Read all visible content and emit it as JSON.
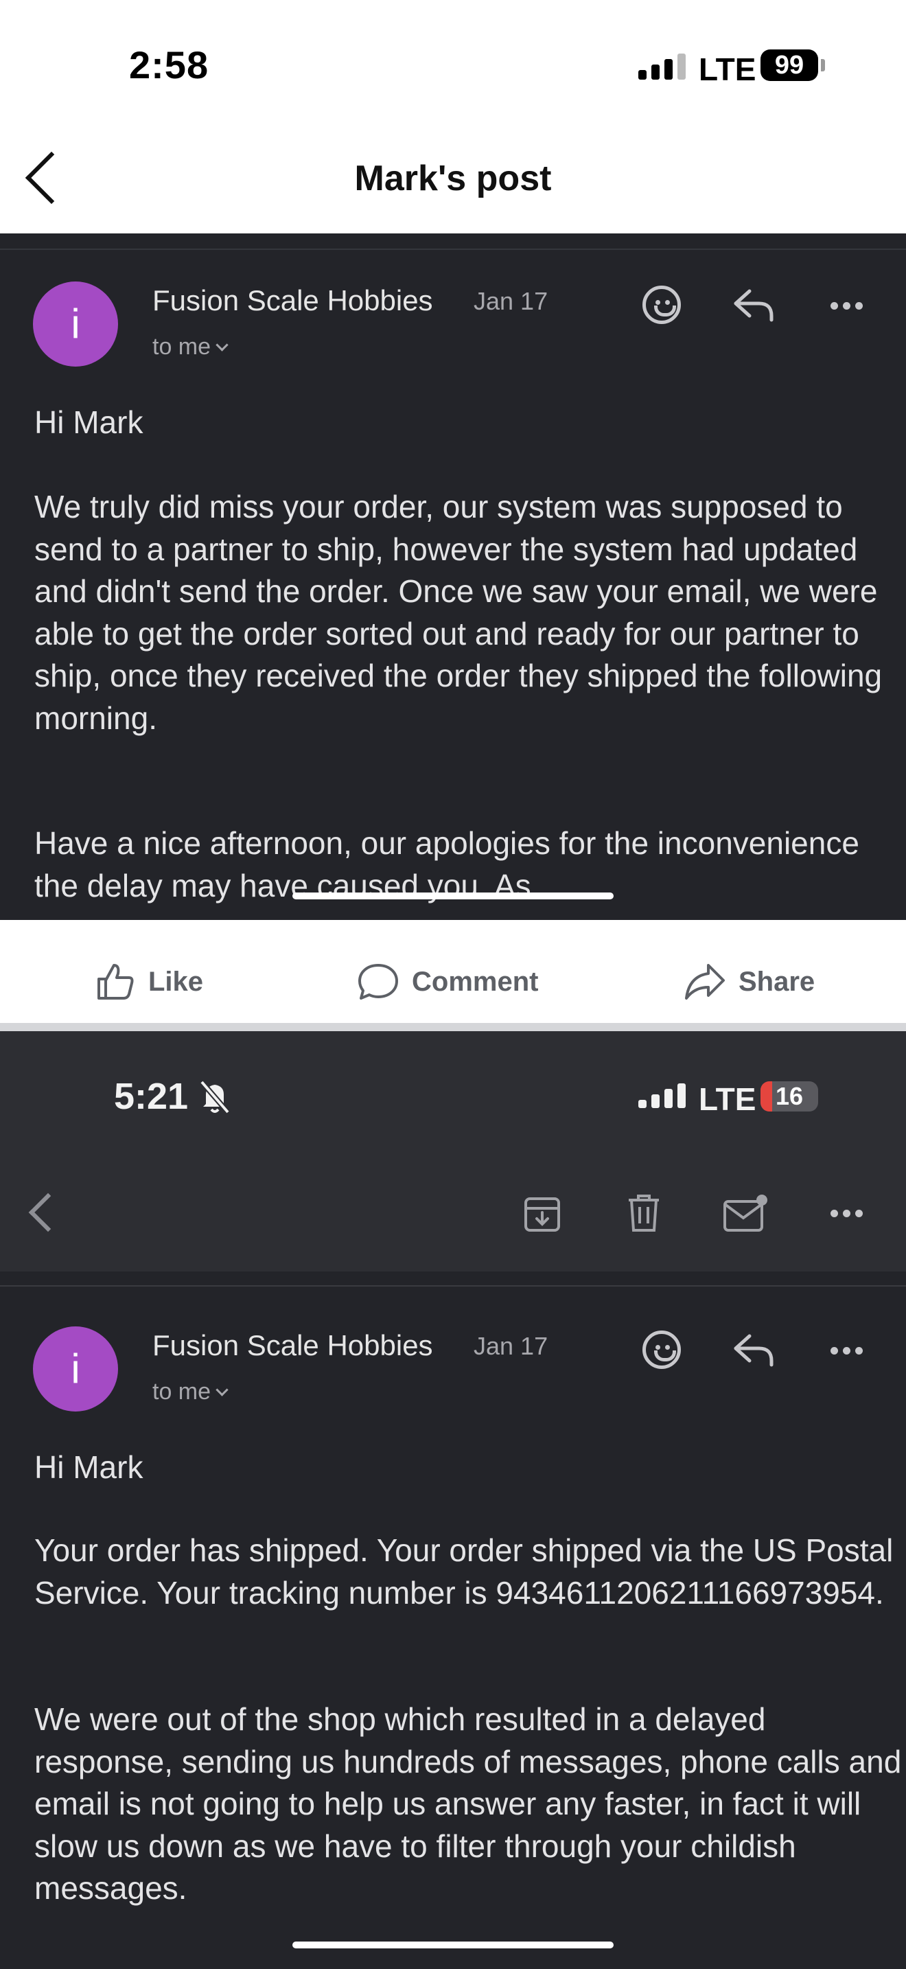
{
  "top_status_bar": {
    "time": "2:58",
    "network": "LTE",
    "battery": "99"
  },
  "post_header": {
    "title": "Mark's post"
  },
  "email1": {
    "avatar_letter": "i",
    "sender": "Fusion Scale Hobbies",
    "date": "Jan 17",
    "recipient": "to me",
    "greeting": "Hi Mark",
    "paragraph1": "We truly did miss your order, our system was supposed to send to a partner to ship, however the system had updated and didn't send the order. Once we saw your email, we were able to get the order sorted out and ready for our partner to ship, once they received the order they shipped the following morning.",
    "paragraph2": "Have a nice afternoon, our apologies for the inconvenience the delay may have caused you. As"
  },
  "post_actions": {
    "like": "Like",
    "comment": "Comment",
    "share": "Share"
  },
  "bottom_status_bar": {
    "time": "5:21",
    "network": "LTE",
    "battery": "16"
  },
  "email2": {
    "avatar_letter": "i",
    "sender": "Fusion Scale Hobbies",
    "date": "Jan 17",
    "recipient": "to me",
    "greeting": "Hi Mark",
    "paragraph1": "Your order has shipped. Your order shipped via the US Postal Service. Your tracking number is 9434611206211166973954.",
    "paragraph2": "We were out of the shop which resulted in a delayed response, sending us hundreds of messages, phone calls and email is not going to help us answer any faster, in fact it will slow us down as we have to filter through your childish messages."
  },
  "colors": {
    "panel": "#232429",
    "avatar": "#a44bc4",
    "battery_low": "#e5453e"
  }
}
